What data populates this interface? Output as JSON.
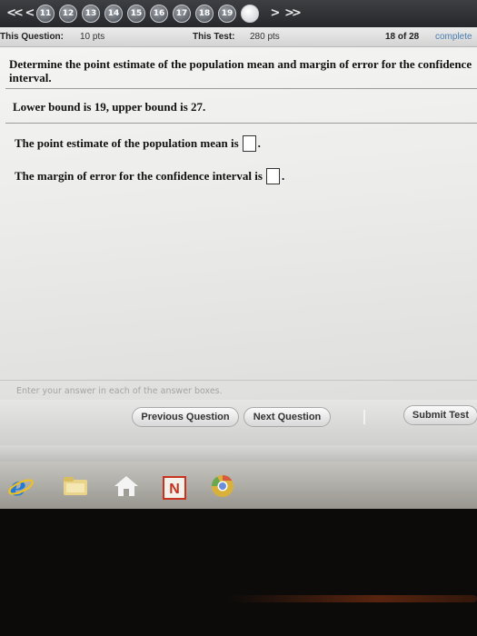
{
  "nav": {
    "first_arrow": "<<",
    "prev_arrow": "<",
    "next_arrow": ">",
    "last_arrow": ">>",
    "questions": [
      "11",
      "12",
      "13",
      "14",
      "15",
      "16",
      "17",
      "18",
      "19"
    ]
  },
  "info": {
    "question_label": "This Question:",
    "question_points": "10 pts",
    "test_label": "This Test:",
    "test_points": "280 pts",
    "progress": "18 of 28",
    "complete_label": "complete"
  },
  "question": {
    "prompt": "Determine the point estimate of the population mean and margin of error for the confidence interval.",
    "bounds": "Lower bound is 19, upper bound is 27.",
    "answer1_label": "The point estimate of the population mean is",
    "answer2_label": "The margin of error for the confidence interval is",
    "period": ".",
    "instructions": "Enter your answer in each of the answer boxes."
  },
  "buttons": {
    "previous": "Previous Question",
    "next": "Next Question",
    "submit": "Submit Test"
  },
  "taskbar": {
    "icons": [
      "internet-explorer-icon",
      "file-explorer-icon",
      "store-icon",
      "onenote-icon",
      "chrome-icon"
    ],
    "onenote_letter": "N"
  },
  "colors": {
    "nav_bg": "#2f3034",
    "complete_text": "#4a7fb0",
    "ie_blue": "#1f7ad8",
    "onenote_red": "#c8321e"
  }
}
